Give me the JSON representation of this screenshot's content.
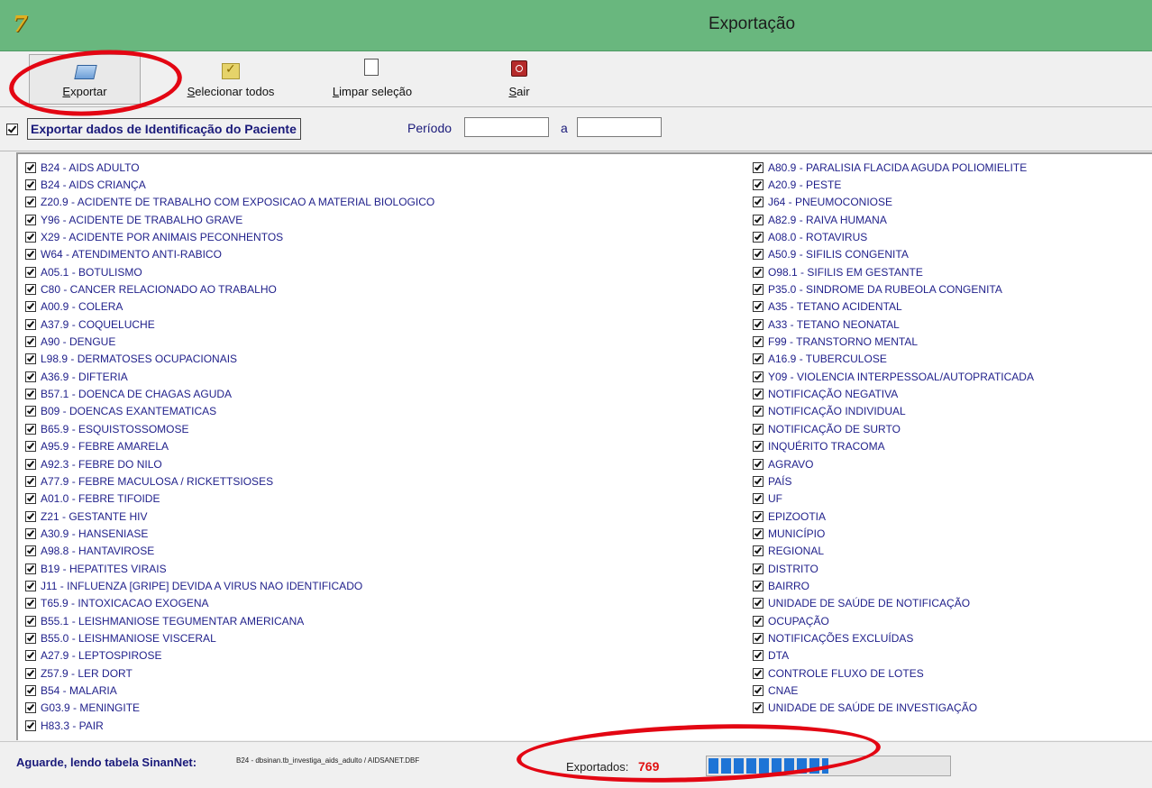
{
  "window": {
    "title": "Exportação",
    "logo_text": "7"
  },
  "toolbar": {
    "export_label_u": "E",
    "export_label_rest": "xportar",
    "select_all_u": "S",
    "select_all_rest": "elecionar todos",
    "clear_u": "L",
    "clear_rest": "impar seleção",
    "exit_u": "S",
    "exit_rest": "air"
  },
  "options": {
    "export_identification_label": "Exportar dados de Identificação do Paciente",
    "export_identification_checked": true,
    "period_label": "Período",
    "period_start": "",
    "period_to_label": "a",
    "period_end": ""
  },
  "list_left": [
    "B24 - AIDS ADULTO",
    "B24 - AIDS CRIANÇA",
    "Z20.9 - ACIDENTE DE TRABALHO COM EXPOSICAO A MATERIAL BIOLOGICO",
    "Y96 - ACIDENTE DE TRABALHO GRAVE",
    "X29 - ACIDENTE POR ANIMAIS PECONHENTOS",
    "W64 - ATENDIMENTO ANTI-RABICO",
    "A05.1 - BOTULISMO",
    "C80 - CANCER RELACIONADO AO TRABALHO",
    "A00.9 - COLERA",
    "A37.9 - COQUELUCHE",
    "A90 - DENGUE",
    "L98.9 - DERMATOSES OCUPACIONAIS",
    "A36.9 - DIFTERIA",
    "B57.1 - DOENCA DE CHAGAS AGUDA",
    "B09 - DOENCAS EXANTEMATICAS",
    "B65.9 - ESQUISTOSSOMOSE",
    "A95.9 - FEBRE AMARELA",
    "A92.3 - FEBRE DO NILO",
    "A77.9 - FEBRE MACULOSA / RICKETTSIOSES",
    "A01.0 - FEBRE TIFOIDE",
    "Z21 - GESTANTE HIV",
    "A30.9 - HANSENIASE",
    "A98.8 - HANTAVIROSE",
    "B19 - HEPATITES VIRAIS",
    "J11 - INFLUENZA [GRIPE] DEVIDA A VIRUS NAO IDENTIFICADO",
    "T65.9 - INTOXICACAO EXOGENA",
    "B55.1 - LEISHMANIOSE TEGUMENTAR AMERICANA",
    "B55.0 - LEISHMANIOSE VISCERAL",
    "A27.9 - LEPTOSPIROSE",
    "Z57.9 - LER DORT",
    "B54 - MALARIA",
    "G03.9 - MENINGITE",
    "H83.3 - PAIR"
  ],
  "list_right": [
    "A80.9 - PARALISIA FLACIDA AGUDA  POLIOMIELITE",
    "A20.9 - PESTE",
    "J64 - PNEUMOCONIOSE",
    "A82.9 - RAIVA HUMANA",
    "A08.0 - ROTAVIRUS",
    "A50.9 - SIFILIS CONGENITA",
    "O98.1 - SIFILIS EM GESTANTE",
    "P35.0 - SINDROME DA RUBEOLA CONGENITA",
    "A35 - TETANO ACIDENTAL",
    "A33 - TETANO NEONATAL",
    "F99 - TRANSTORNO MENTAL",
    "A16.9 - TUBERCULOSE",
    "Y09 - VIOLENCIA INTERPESSOAL/AUTOPRATICADA",
    "NOTIFICAÇÃO NEGATIVA",
    "NOTIFICAÇÃO INDIVIDUAL",
    "NOTIFICAÇÃO DE SURTO",
    "INQUÉRITO TRACOMA",
    "AGRAVO",
    "PAÍS",
    "UF",
    "EPIZOOTIA",
    "MUNICÍPIO",
    "REGIONAL",
    "DISTRITO",
    "BAIRRO",
    "UNIDADE DE SAÚDE DE NOTIFICAÇÃO",
    "OCUPAÇÃO",
    "NOTIFICAÇÕES EXCLUÍDAS",
    "DTA",
    "CONTROLE FLUXO DE LOTES",
    "CNAE",
    "UNIDADE DE SAÚDE DE INVESTIGAÇÃO"
  ],
  "status": {
    "message": "Aguarde, lendo tabela SinanNet:",
    "file": "B24 - dbsinan.tb_investiga_aids_adulto / AIDSANET.DBF",
    "exported_label": "Exportados:",
    "exported_count": "769",
    "progress_fraction": 0.5
  }
}
